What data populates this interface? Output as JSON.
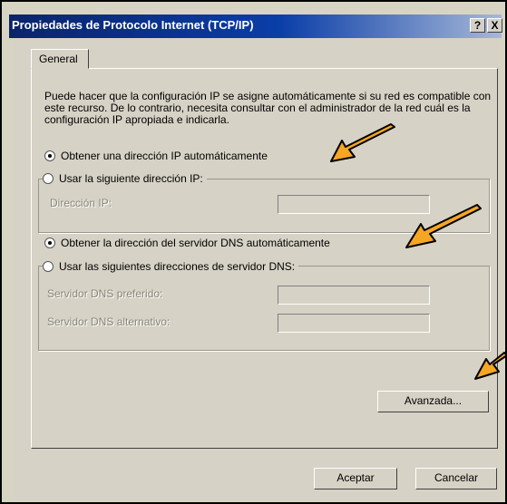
{
  "window": {
    "title": "Propiedades de Protocolo Internet (TCP/IP)",
    "help_button": "?",
    "close_button": "X"
  },
  "tabs": [
    {
      "label": "General",
      "selected": true
    }
  ],
  "description": "Puede hacer que la configuración IP se asigne automáticamente si su red es compatible con este recurso. De lo contrario, necesita consultar con el administrador de la red cuál es la configuración IP apropiada e indicarla.",
  "ip": {
    "auto_option": "Obtener una dirección IP automáticamente",
    "auto_selected": true,
    "manual_option": "Usar la siguiente dirección IP:",
    "manual_selected": false,
    "address_label": "Dirección IP:",
    "address_value": ""
  },
  "dns": {
    "auto_option": "Obtener la dirección del servidor DNS automáticamente",
    "auto_selected": true,
    "manual_option": "Usar las siguientes direcciones de servidor DNS:",
    "manual_selected": false,
    "preferred_label": "Servidor DNS preferido:",
    "preferred_value": "",
    "alternate_label": "Servidor DNS alternativo:",
    "alternate_value": ""
  },
  "buttons": {
    "advanced": "Avanzada...",
    "ok": "Aceptar",
    "cancel": "Cancelar"
  },
  "colors": {
    "title_gradient_start": "#0a246a",
    "arrow": "#f5a623"
  },
  "icons": {
    "annotation": "orange-arrow-icon"
  }
}
